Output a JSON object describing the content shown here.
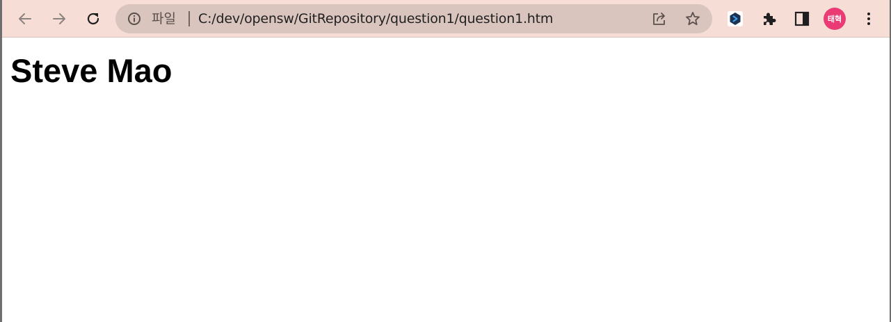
{
  "toolbar": {
    "back_icon": "arrow-left-icon",
    "forward_icon": "arrow-right-icon",
    "reload_icon": "reload-icon",
    "address_bar": {
      "security_icon": "info-circle-icon",
      "security_label": "파일",
      "url": "C:/dev/opensw/GitRepository/question1/question1.htm",
      "share_icon": "share-icon",
      "bookmark_icon": "star-icon"
    },
    "extension_icon": "extension-app-icon",
    "extensions_menu_icon": "puzzle-icon",
    "side_panel_icon": "side-panel-icon",
    "profile_label": "태혁",
    "menu_icon": "kebab-menu-icon"
  },
  "page": {
    "heading": "Steve Mao"
  },
  "colors": {
    "toolbar_bg": "#f6ded6",
    "omnibox_bg": "#d9c5be",
    "avatar_bg": "#ea3b74",
    "page_bg": "#ffffff"
  }
}
